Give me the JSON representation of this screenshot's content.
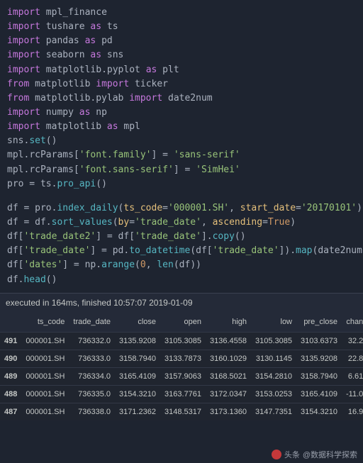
{
  "code": {
    "l1": {
      "kw1": "import",
      "m": "mpl_finance"
    },
    "l2": {
      "kw1": "import",
      "m": "tushare",
      "kw2": "as",
      "a": "ts"
    },
    "l3": {
      "kw1": "import",
      "m": "pandas",
      "kw2": "as",
      "a": "pd"
    },
    "l4": {
      "kw1": "import",
      "m": "seaborn",
      "kw2": "as",
      "a": "sns"
    },
    "l5": {
      "kw1": "import",
      "m": "matplotlib.pyplot",
      "kw2": "as",
      "a": "plt"
    },
    "l6": {
      "kw1": "from",
      "m": "matplotlib",
      "kw2": "import",
      "a": "ticker"
    },
    "l7": {
      "kw1": "from",
      "m": "matplotlib.pylab",
      "kw2": "import",
      "a": "date2num"
    },
    "l8": {
      "kw1": "import",
      "m": "numpy",
      "kw2": "as",
      "a": "np"
    },
    "l9": {
      "kw1": "import",
      "m": "matplotlib",
      "kw2": "as",
      "a": "mpl"
    },
    "l10": {
      "obj": "sns",
      "fn": "set",
      "par": "()"
    },
    "l11": {
      "obj": "mpl",
      "attr": "rcParams",
      "key": "'font.family'",
      "eq": " = ",
      "val": "'sans-serif'"
    },
    "l12": {
      "obj": "mpl",
      "attr": "rcParams",
      "key": "'font.sans-serif'",
      "eq": " = ",
      "val": "'SimHei'"
    },
    "l13": {
      "lhs": "pro",
      "eq": " = ",
      "obj": "ts",
      "fn": "pro_api",
      "par": "()"
    },
    "l14": {
      "lhs": "df",
      "eq": " = ",
      "obj": "pro",
      "fn": "index_daily",
      "p1": "ts_code",
      "v1": "'000001.SH'",
      "p2": "start_date",
      "v2": "'20170101'"
    },
    "l15": {
      "lhs": "df",
      "eq": " = ",
      "obj": "df",
      "fn": "sort_values",
      "p1": "by",
      "v1": "'trade_date'",
      "p2": "ascending",
      "b": "True"
    },
    "l16": {
      "lhs": "df",
      "k": "'trade_date2'",
      "eq": " = ",
      "obj": "df",
      "k2": "'trade_date'",
      "fn": "copy",
      "par": "()"
    },
    "l17": {
      "lhs": "df",
      "k": "'trade_date'",
      "eq": " = ",
      "obj": "pd",
      "fn": "to_datetime",
      "arg": "df",
      "k2": "'trade_date'",
      "map": "map",
      "d2n": "date2num"
    },
    "l18": {
      "lhs": "df",
      "k": "'dates'",
      "eq": " = ",
      "obj": "np",
      "fn": "arange",
      "n0": "0",
      "len": "len",
      "arg": "df"
    },
    "l19": {
      "obj": "df",
      "fn": "head",
      "par": "()"
    }
  },
  "exec_status": "executed in 164ms, finished 10:57:07 2019-01-09",
  "table": {
    "headers": [
      "",
      "ts_code",
      "trade_date",
      "close",
      "open",
      "high",
      "low",
      "pre_close",
      "chan"
    ],
    "rows": [
      [
        "491",
        "000001.SH",
        "736332.0",
        "3135.9208",
        "3105.3085",
        "3136.4558",
        "3105.3085",
        "3103.6373",
        "32.2"
      ],
      [
        "490",
        "000001.SH",
        "736333.0",
        "3158.7940",
        "3133.7873",
        "3160.1029",
        "3130.1145",
        "3135.9208",
        "22.8"
      ],
      [
        "489",
        "000001.SH",
        "736334.0",
        "3165.4109",
        "3157.9063",
        "3168.5021",
        "3154.2810",
        "3158.7940",
        "6.61"
      ],
      [
        "488",
        "000001.SH",
        "736335.0",
        "3154.3210",
        "3163.7761",
        "3172.0347",
        "3153.0253",
        "3165.4109",
        "-11.0"
      ],
      [
        "487",
        "000001.SH",
        "736338.0",
        "3171.2362",
        "3148.5317",
        "3173.1360",
        "3147.7351",
        "3154.3210",
        "16.9"
      ]
    ]
  },
  "watermark": {
    "prefix": "头条",
    "suffix": "@数据科学探索"
  }
}
